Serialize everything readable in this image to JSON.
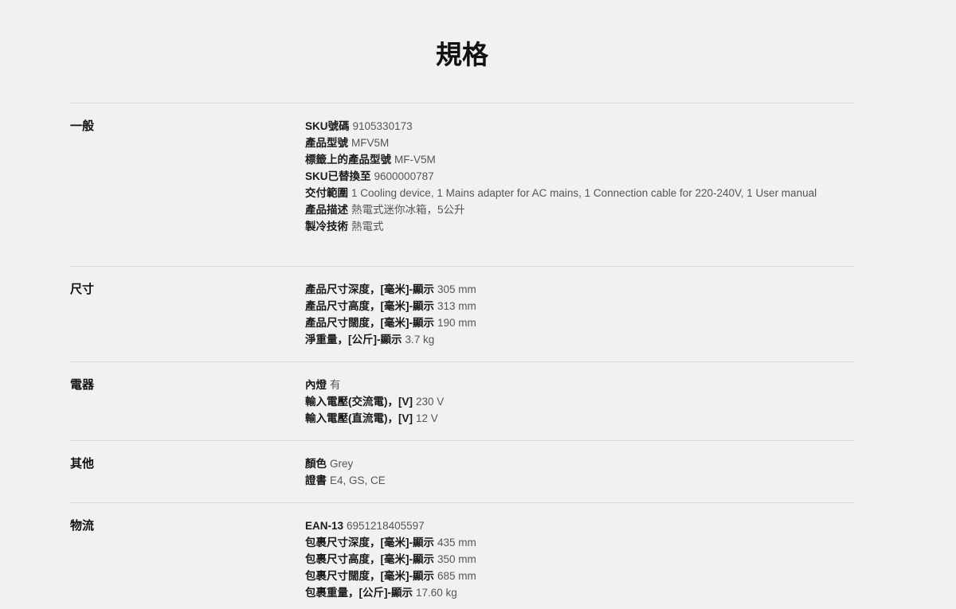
{
  "page": {
    "title": "規格"
  },
  "sections": [
    {
      "title": "一般",
      "rows": [
        {
          "label": "SKU號碼",
          "value": "9105330173"
        },
        {
          "label": "產品型號",
          "value": "MFV5M"
        },
        {
          "label": "標籤上的產品型號",
          "value": "MF-V5M"
        },
        {
          "label": "SKU已替換至",
          "value": "9600000787"
        },
        {
          "label": "交付範圍",
          "value": "1 Cooling device, 1 Mains adapter for AC mains, 1 Connection cable for 220-240V, 1 User manual"
        },
        {
          "label": "產品描述",
          "value": "熱電式迷你冰箱，5公升"
        },
        {
          "label": "製冷技術",
          "value": "熱電式"
        }
      ]
    },
    {
      "title": "尺寸",
      "rows": [
        {
          "label": "產品尺寸深度，[毫米]-顯示",
          "value": "305 mm"
        },
        {
          "label": "產品尺寸高度，[毫米]-顯示",
          "value": "313 mm"
        },
        {
          "label": "產品尺寸闊度，[毫米]-顯示",
          "value": "190 mm"
        },
        {
          "label": "淨重量，[公斤]-顯示",
          "value": "3.7 kg"
        }
      ]
    },
    {
      "title": "電器",
      "rows": [
        {
          "label": "內燈",
          "value": "有"
        },
        {
          "label": "輸入電壓(交流電)，[V]",
          "value": "230 V"
        },
        {
          "label": "輸入電壓(直流電)，[V]",
          "value": "12 V"
        }
      ]
    },
    {
      "title": "其他",
      "rows": [
        {
          "label": "顏色",
          "value": "Grey"
        },
        {
          "label": "證書",
          "value": "E4, GS, CE"
        }
      ]
    },
    {
      "title": "物流",
      "rows": [
        {
          "label": "EAN-13",
          "value": "6951218405597"
        },
        {
          "label": "包裹尺寸深度，[毫米]-顯示",
          "value": "435 mm"
        },
        {
          "label": "包裹尺寸高度，[毫米]-顯示",
          "value": "350 mm"
        },
        {
          "label": "包裹尺寸闊度，[毫米]-顯示",
          "value": "685 mm"
        },
        {
          "label": "包裹重量，[公斤]-顯示",
          "value": "17.60 kg"
        }
      ]
    }
  ]
}
